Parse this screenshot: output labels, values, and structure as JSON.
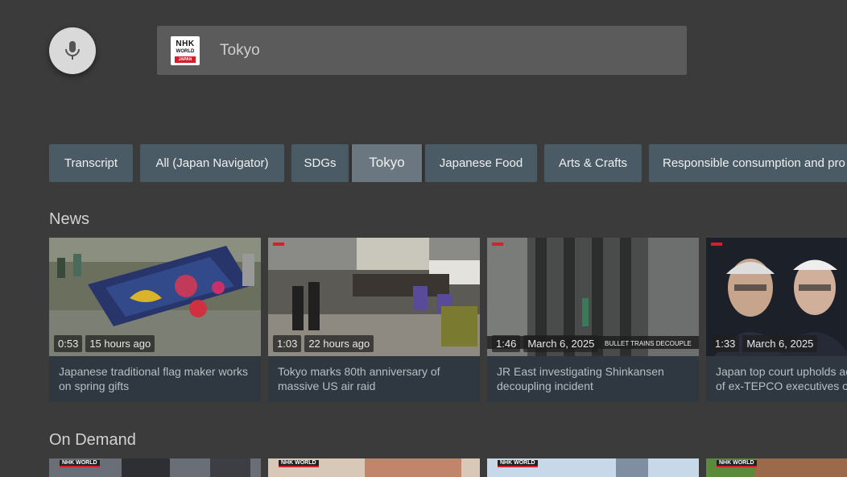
{
  "search": {
    "mic_icon": "microphone-icon",
    "logo_top": "NHK",
    "logo_mid": "WORLD",
    "logo_bottom": "JAPAN",
    "query": "Tokyo"
  },
  "chips": [
    {
      "label": "Transcript",
      "active": false
    },
    {
      "label": "All (Japan Navigator)",
      "active": false
    },
    {
      "label": "SDGs",
      "active": false
    },
    {
      "label": "Tokyo",
      "active": true
    },
    {
      "label": "Japanese Food",
      "active": false
    },
    {
      "label": "Arts & Crafts",
      "active": false
    },
    {
      "label": "Responsible consumption and pro",
      "active": false
    }
  ],
  "news": {
    "title": "News",
    "cards": [
      {
        "duration": "0:53",
        "age": "15 hours ago",
        "line1": "Japanese traditional flag maker works",
        "line2": "on spring gifts"
      },
      {
        "duration": "1:03",
        "age": "22 hours ago",
        "line1": "Tokyo marks 80th anniversary of",
        "line2": "massive US air raid"
      },
      {
        "duration": "1:46",
        "age": "March 6, 2025",
        "line1": "JR East investigating Shinkansen",
        "line2": "decoupling incident",
        "caption": "BULLET TRAINS DECOUPLE"
      },
      {
        "duration": "1:33",
        "age": "March 6, 2025",
        "line1": "Japan top court upholds ac",
        "line2": "of ex-TEPCO executives on"
      }
    ]
  },
  "on_demand": {
    "title": "On Demand",
    "logo": "NHK WORLD"
  },
  "colors": {
    "background": "#3b3b3b",
    "chip": "#4a5b66",
    "chip_active": "#6a7780",
    "card": "#2f3840",
    "nhk_red": "#d3202a"
  }
}
